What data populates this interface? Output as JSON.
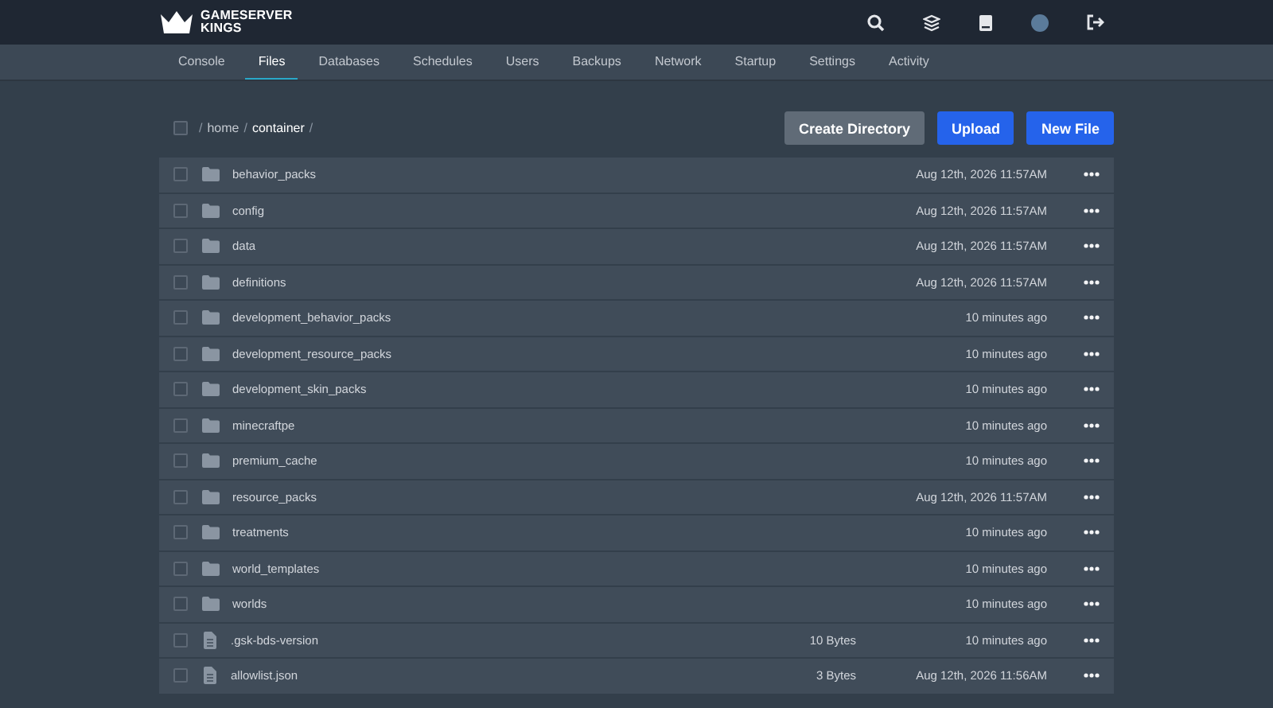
{
  "brand": {
    "line1": "GAMESERVER",
    "line2": "KINGS"
  },
  "tabs": [
    {
      "label": "Console",
      "selected": false
    },
    {
      "label": "Files",
      "selected": true
    },
    {
      "label": "Databases",
      "selected": false
    },
    {
      "label": "Schedules",
      "selected": false
    },
    {
      "label": "Users",
      "selected": false
    },
    {
      "label": "Backups",
      "selected": false
    },
    {
      "label": "Network",
      "selected": false
    },
    {
      "label": "Startup",
      "selected": false
    },
    {
      "label": "Settings",
      "selected": false
    },
    {
      "label": "Activity",
      "selected": false
    }
  ],
  "breadcrumb": {
    "select_all_checked": false,
    "parts": [
      {
        "text": "/",
        "kind": "separator"
      },
      {
        "text": "home",
        "kind": "link"
      },
      {
        "text": "/",
        "kind": "separator"
      },
      {
        "text": "container",
        "kind": "current"
      },
      {
        "text": "/",
        "kind": "separator"
      }
    ]
  },
  "buttons": [
    {
      "label": "Create Directory",
      "kind": "secondary"
    },
    {
      "label": "Upload",
      "kind": "primary"
    },
    {
      "label": "New File",
      "kind": "primary"
    }
  ],
  "files": [
    {
      "kind": "folder",
      "name": "behavior_packs",
      "modified": "Aug 12th, 2026 11:57AM",
      "checked": false
    },
    {
      "kind": "folder",
      "name": "config",
      "modified": "Aug 12th, 2026 11:57AM",
      "checked": false
    },
    {
      "kind": "folder",
      "name": "data",
      "modified": "Aug 12th, 2026 11:57AM",
      "checked": false
    },
    {
      "kind": "folder",
      "name": "definitions",
      "modified": "Aug 12th, 2026 11:57AM",
      "checked": false
    },
    {
      "kind": "folder",
      "name": "development_behavior_packs",
      "modified": "10 minutes ago",
      "checked": false
    },
    {
      "kind": "folder",
      "name": "development_resource_packs",
      "modified": "10 minutes ago",
      "checked": false
    },
    {
      "kind": "folder",
      "name": "development_skin_packs",
      "modified": "10 minutes ago",
      "checked": false
    },
    {
      "kind": "folder",
      "name": "minecraftpe",
      "modified": "10 minutes ago",
      "checked": false
    },
    {
      "kind": "folder",
      "name": "premium_cache",
      "modified": "10 minutes ago",
      "checked": false
    },
    {
      "kind": "folder",
      "name": "resource_packs",
      "modified": "Aug 12th, 2026 11:57AM",
      "checked": false
    },
    {
      "kind": "folder",
      "name": "treatments",
      "modified": "10 minutes ago",
      "checked": false
    },
    {
      "kind": "folder",
      "name": "world_templates",
      "modified": "10 minutes ago",
      "checked": false
    },
    {
      "kind": "folder",
      "name": "worlds",
      "modified": "10 minutes ago",
      "checked": false
    },
    {
      "kind": "file",
      "name": ".gsk-bds-version",
      "size": "10 Bytes",
      "modified": "10 minutes ago",
      "checked": false
    },
    {
      "kind": "file",
      "name": "allowlist.json",
      "size": "3 Bytes",
      "modified": "Aug 12th, 2026 11:56AM",
      "checked": false
    }
  ]
}
